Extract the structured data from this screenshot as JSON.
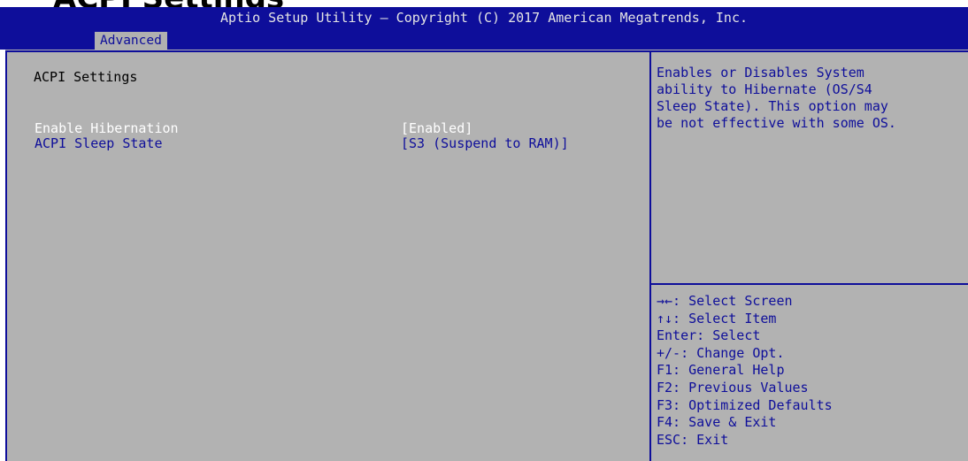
{
  "header": {
    "title": "Aptio Setup Utility – Copyright (C) 2017 American Megatrends, Inc.",
    "tab": "Advanced"
  },
  "page_heading_cut": "ACPI Settings",
  "section": {
    "title": "ACPI Settings"
  },
  "settings": [
    {
      "label": "Enable Hibernation",
      "value": "[Enabled]",
      "selected": true
    },
    {
      "label": "ACPI Sleep State",
      "value": "[S3 (Suspend to RAM)]",
      "selected": false
    }
  ],
  "help": {
    "lines": [
      "Enables or Disables System",
      "ability to Hibernate (OS/S4",
      "Sleep State). This option may",
      "be not effective with some OS."
    ]
  },
  "keys": [
    "→←: Select Screen",
    "↑↓: Select Item",
    "Enter: Select",
    "+/-: Change Opt.",
    "F1: General Help",
    "F2: Previous Values",
    "F3: Optimized Defaults",
    "F4: Save & Exit",
    "ESC: Exit"
  ],
  "colors": {
    "frame_blue": "#0e0e9a",
    "panel_gray": "#b2b2b2",
    "selected_text": "#ffffff",
    "option_text": "#0e0e9a"
  }
}
